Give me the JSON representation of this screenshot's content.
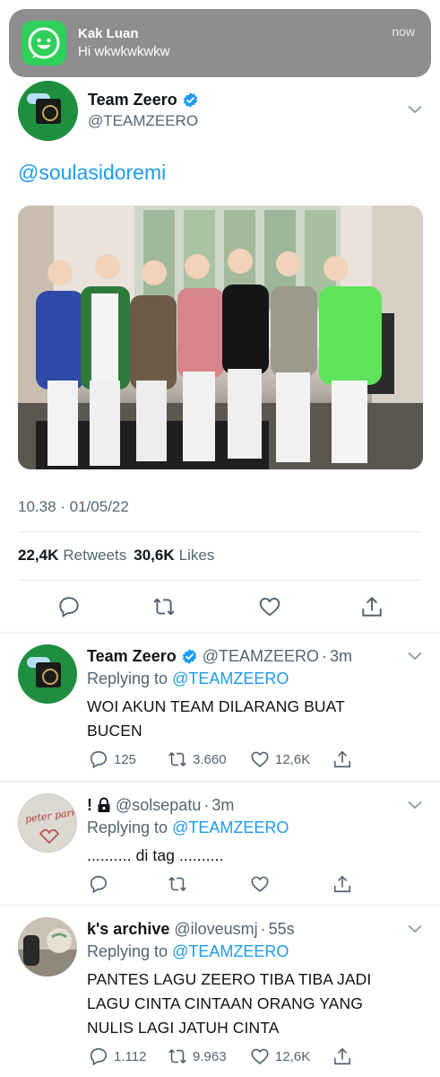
{
  "notification": {
    "sender": "Kak Luan",
    "message": "Hi wkwkwkwkw",
    "time": "now",
    "app_icon": "whatsapp-like-smile-icon",
    "accent": "#2fd05a"
  },
  "main_tweet": {
    "name": "Team Zeero",
    "handle": "@TEAMZEERO",
    "verified": true,
    "text": "@soulasidoremi",
    "timestamp": "10.38 · 01/05/22",
    "retweets_count": "22,4K",
    "retweets_label": "Retweets",
    "likes_count": "30,6K",
    "likes_label": "Likes",
    "actions": [
      "reply-icon",
      "retweet-icon",
      "like-icon",
      "share-icon"
    ]
  },
  "replies": [
    {
      "name": "Team Zeero",
      "handle": "@TEAMZEERO",
      "time": "3m",
      "verified": true,
      "replying_prefix": "Replying to ",
      "replying_to": "@TEAMZEERO",
      "text_lines": [
        "WOI AKUN TEAM DILARANG BUAT",
        "BUCEN"
      ],
      "reply_count": "125",
      "retweet_count": "3.660",
      "like_count": "12,6K"
    },
    {
      "name": "!",
      "handle": "@solsepatu",
      "time": "3m",
      "locked": true,
      "replying_prefix": "Replying to ",
      "replying_to": "@TEAMZEERO",
      "text_lines": [
        ".......... di tag .........."
      ],
      "reply_count": "",
      "retweet_count": "",
      "like_count": ""
    },
    {
      "name": "k's archive",
      "handle": "@iloveusmj",
      "time": "55s",
      "replying_prefix": "Replying to ",
      "replying_to": "@TEAMZEERO",
      "text_lines": [
        "PANTES LAGU ZEERO TIBA TIBA JADI",
        "LAGU CINTA CINTAAN ORANG YANG",
        "NULIS LAGI JATUH CINTA"
      ],
      "reply_count": "1.112",
      "retweet_count": "9.963",
      "like_count": "12,6K"
    }
  ],
  "colors": {
    "link": "#1d9bf0",
    "secondary": "#536471",
    "primary": "#0f1419",
    "divider": "#e6e9ec"
  },
  "avatar_texts": {
    "solsepatu": "peter parker"
  }
}
